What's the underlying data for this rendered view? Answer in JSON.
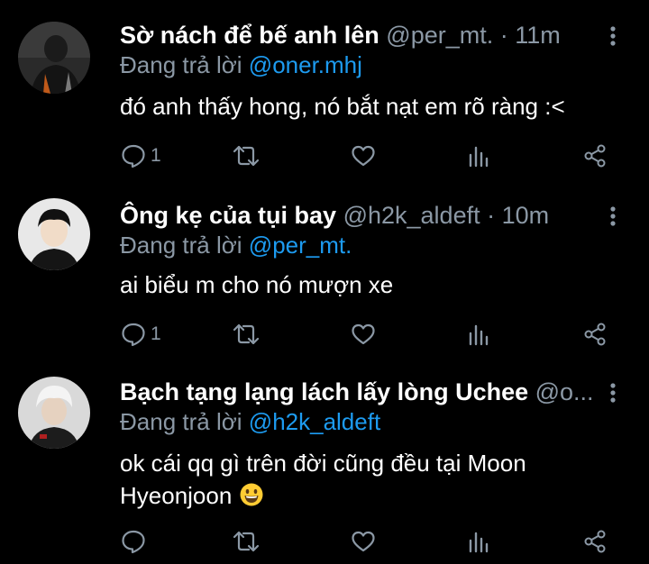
{
  "colors": {
    "background": "#000000",
    "name": "#ffffff",
    "secondary": "#8b98a5",
    "mention": "#1d9bf0"
  },
  "tweets": [
    {
      "display_name": "Sờ nách để bế anh lên",
      "handle": "@per_mt.",
      "separator": "·",
      "time": "11m",
      "reply_prefix": "Đang trả lời",
      "reply_to": "@oner.mhj",
      "text": "đó anh thấy hong, nó bắt nạt em rõ ràng :<",
      "reply_count": "1",
      "icons": [
        "comment-icon",
        "retweet-icon",
        "heart-icon",
        "analytics-icon",
        "share-icon",
        "more-icon"
      ]
    },
    {
      "display_name": "Ông kẹ của tụi bay",
      "handle": "@h2k_aldeft",
      "separator": "·",
      "time": "10m",
      "reply_prefix": "Đang trả lời",
      "reply_to": "@per_mt.",
      "text": "ai biểu m cho nó mượn xe",
      "reply_count": "1",
      "icons": [
        "comment-icon",
        "retweet-icon",
        "heart-icon",
        "analytics-icon",
        "share-icon",
        "more-icon"
      ]
    },
    {
      "display_name": "Bạch tạng lạng lách lấy lòng Uchee",
      "handle": "@o...",
      "reply_prefix": "Đang trả lời",
      "reply_to": "@h2k_aldeft",
      "text_line1": "ok cái qq gì trên đời cũng đều tại Moon",
      "text_line2": "Hyeonjoon",
      "emoji": "grinning-face-emoji",
      "reply_count": "",
      "icons": [
        "comment-icon",
        "retweet-icon",
        "heart-icon",
        "analytics-icon",
        "share-icon",
        "more-icon"
      ]
    }
  ]
}
